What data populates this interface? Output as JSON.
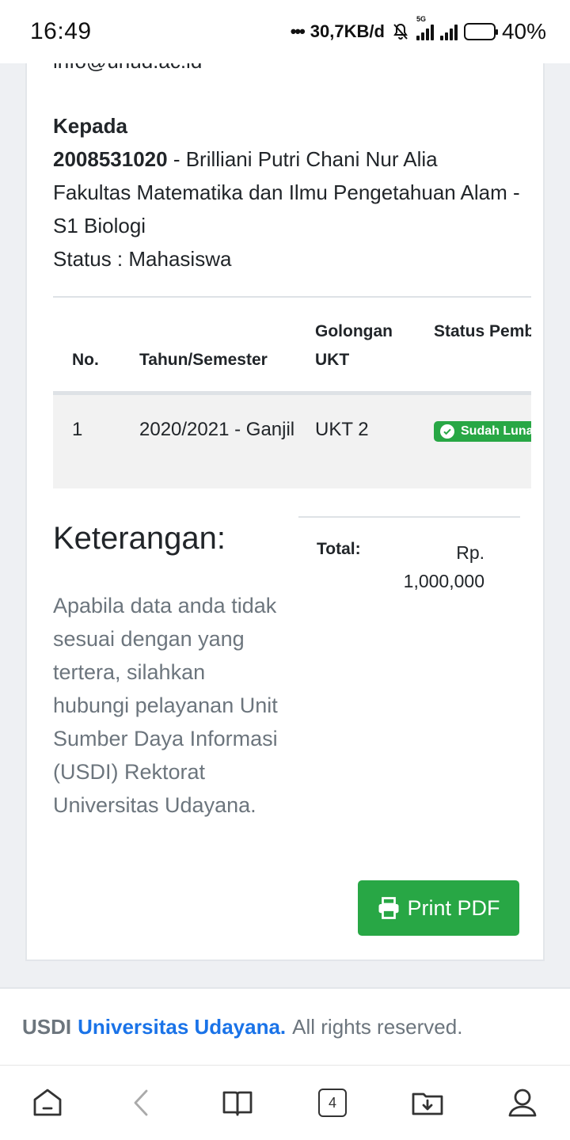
{
  "status_bar": {
    "time": "16:49",
    "speed": "30,7KB/d",
    "network": "5G",
    "battery": "40%",
    "battery_level": 0.4
  },
  "invoice": {
    "email_partial": "info@unud.ac.id",
    "recipient": {
      "label": "Kepada",
      "nim": "2008531020",
      "name_sep": " - Brilliani Putri Chani Nur Alia",
      "faculty": "Fakultas Matematika dan Ilmu Pengetahuan Alam - S1 Biologi",
      "status": "Status : Mahasiswa"
    },
    "table": {
      "headers": {
        "no": "No.",
        "tahun": "Tahun/Semester",
        "golongan": "Golongan UKT",
        "status": "Status Pembayaran"
      },
      "rows": [
        {
          "no": "1",
          "tahun": "2020/2021 - Ganjil",
          "golongan": "UKT 2",
          "status": "Sudah Lunas"
        }
      ]
    },
    "keterangan": {
      "title": "Keterangan:",
      "body": "Apabila data anda tidak sesuai dengan yang tertera, silahkan hubungi pelayanan Unit Sumber Daya Informasi (USDI) Rektorat Universitas Udayana."
    },
    "total": {
      "label": "Total:",
      "value": "Rp. 1,000,000"
    },
    "print_button": "Print PDF"
  },
  "footer": {
    "brand": "USDI",
    "link": "Universitas Udayana.",
    "rights": "All rights reserved."
  },
  "bottom_nav": {
    "tab_count": "4"
  },
  "colors": {
    "success": "#28a745",
    "link": "#1a73e8",
    "muted": "#6c757d"
  }
}
